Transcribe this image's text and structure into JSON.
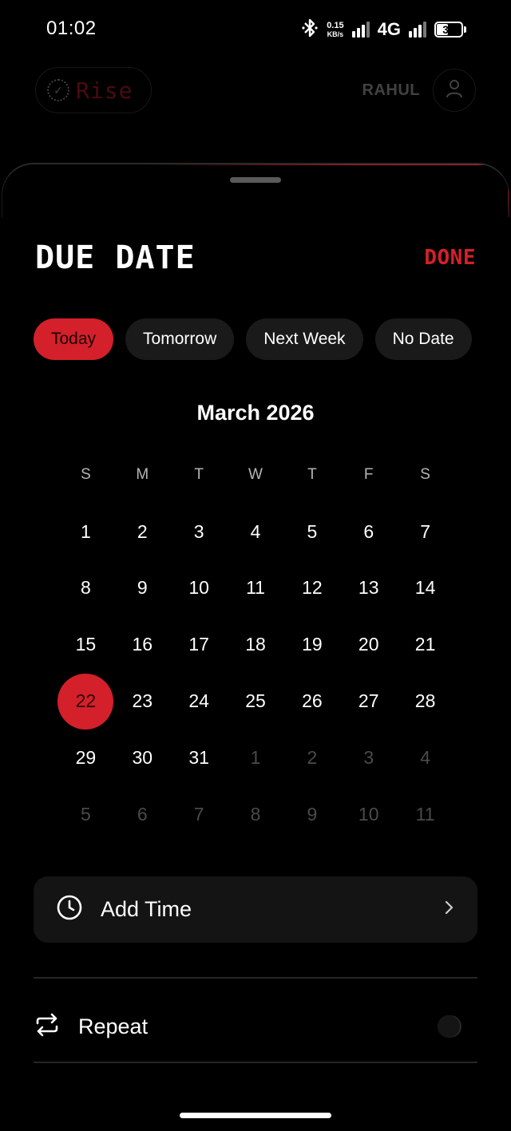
{
  "status_bar": {
    "time": "01:02",
    "net_speed_value": "0.15",
    "net_speed_unit": "KB/s",
    "network_type": "4G",
    "battery_level": "37"
  },
  "app_header": {
    "logo_text": "Rise",
    "user_name": "RAHUL"
  },
  "sheet": {
    "title": "DUE DATE",
    "done_label": "DONE",
    "quick_chips": [
      {
        "label": "Today",
        "active": true
      },
      {
        "label": "Tomorrow",
        "active": false
      },
      {
        "label": "Next Week",
        "active": false
      },
      {
        "label": "No Date",
        "active": false
      }
    ],
    "calendar": {
      "month_label": "March 2026",
      "weekdays": [
        "S",
        "M",
        "T",
        "W",
        "T",
        "F",
        "S"
      ],
      "weeks": [
        [
          {
            "d": "1"
          },
          {
            "d": "2"
          },
          {
            "d": "3"
          },
          {
            "d": "4"
          },
          {
            "d": "5"
          },
          {
            "d": "6"
          },
          {
            "d": "7"
          }
        ],
        [
          {
            "d": "8"
          },
          {
            "d": "9"
          },
          {
            "d": "10"
          },
          {
            "d": "11"
          },
          {
            "d": "12"
          },
          {
            "d": "13"
          },
          {
            "d": "14"
          }
        ],
        [
          {
            "d": "15"
          },
          {
            "d": "16"
          },
          {
            "d": "17"
          },
          {
            "d": "18"
          },
          {
            "d": "19"
          },
          {
            "d": "20"
          },
          {
            "d": "21"
          }
        ],
        [
          {
            "d": "22",
            "selected": true
          },
          {
            "d": "23"
          },
          {
            "d": "24"
          },
          {
            "d": "25"
          },
          {
            "d": "26"
          },
          {
            "d": "27"
          },
          {
            "d": "28"
          }
        ],
        [
          {
            "d": "29"
          },
          {
            "d": "30"
          },
          {
            "d": "31"
          },
          {
            "d": "1",
            "muted": true
          },
          {
            "d": "2",
            "muted": true
          },
          {
            "d": "3",
            "muted": true
          },
          {
            "d": "4",
            "muted": true
          }
        ],
        [
          {
            "d": "5",
            "muted": true
          },
          {
            "d": "6",
            "muted": true
          },
          {
            "d": "7",
            "muted": true
          },
          {
            "d": "8",
            "muted": true
          },
          {
            "d": "9",
            "muted": true
          },
          {
            "d": "10",
            "muted": true
          },
          {
            "d": "11",
            "muted": true
          }
        ]
      ]
    },
    "add_time_label": "Add Time",
    "repeat_label": "Repeat",
    "repeat_enabled": false
  },
  "colors": {
    "accent": "#d4202a",
    "background": "#000000",
    "surface": "#141414",
    "chip_bg": "#1a1a1a",
    "muted_text": "#4a4a4a"
  },
  "icons": {
    "add_time": "clock-icon",
    "add_time_chevron": "chevron-right-icon",
    "repeat": "repeat-icon",
    "user": "user-icon",
    "logo": "check-circle-icon"
  }
}
